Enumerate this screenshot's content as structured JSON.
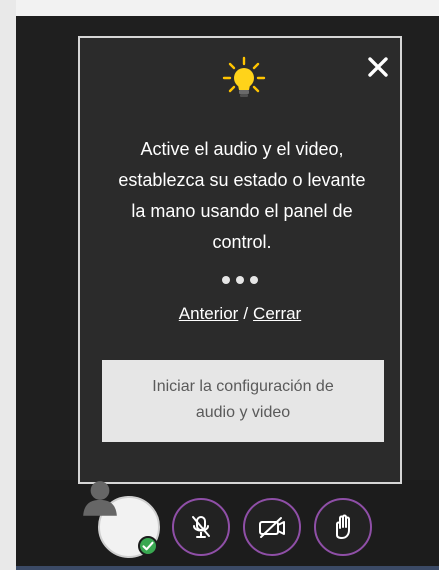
{
  "tooltip": {
    "message": "Active el audio y el video,\nestablezca su estado o levante\nla mano usando el panel de\ncontrol.",
    "links": {
      "previous": "Anterior",
      "separator": "/",
      "close": "Cerrar"
    },
    "button_label": "Iniciar la configuración de\naudio y video"
  },
  "icons": {
    "close": "close-icon",
    "bulb": "lightbulb-icon",
    "avatar": "user-avatar-icon",
    "status": "checkmark-icon",
    "mic": "microphone-muted-icon",
    "camera": "camera-off-icon",
    "hand": "raise-hand-icon"
  },
  "colors": {
    "accent": "#8f4fa7",
    "status": "#39a851",
    "panel_bg": "#2b2b2b",
    "button_bg": "#e6e6e6"
  }
}
